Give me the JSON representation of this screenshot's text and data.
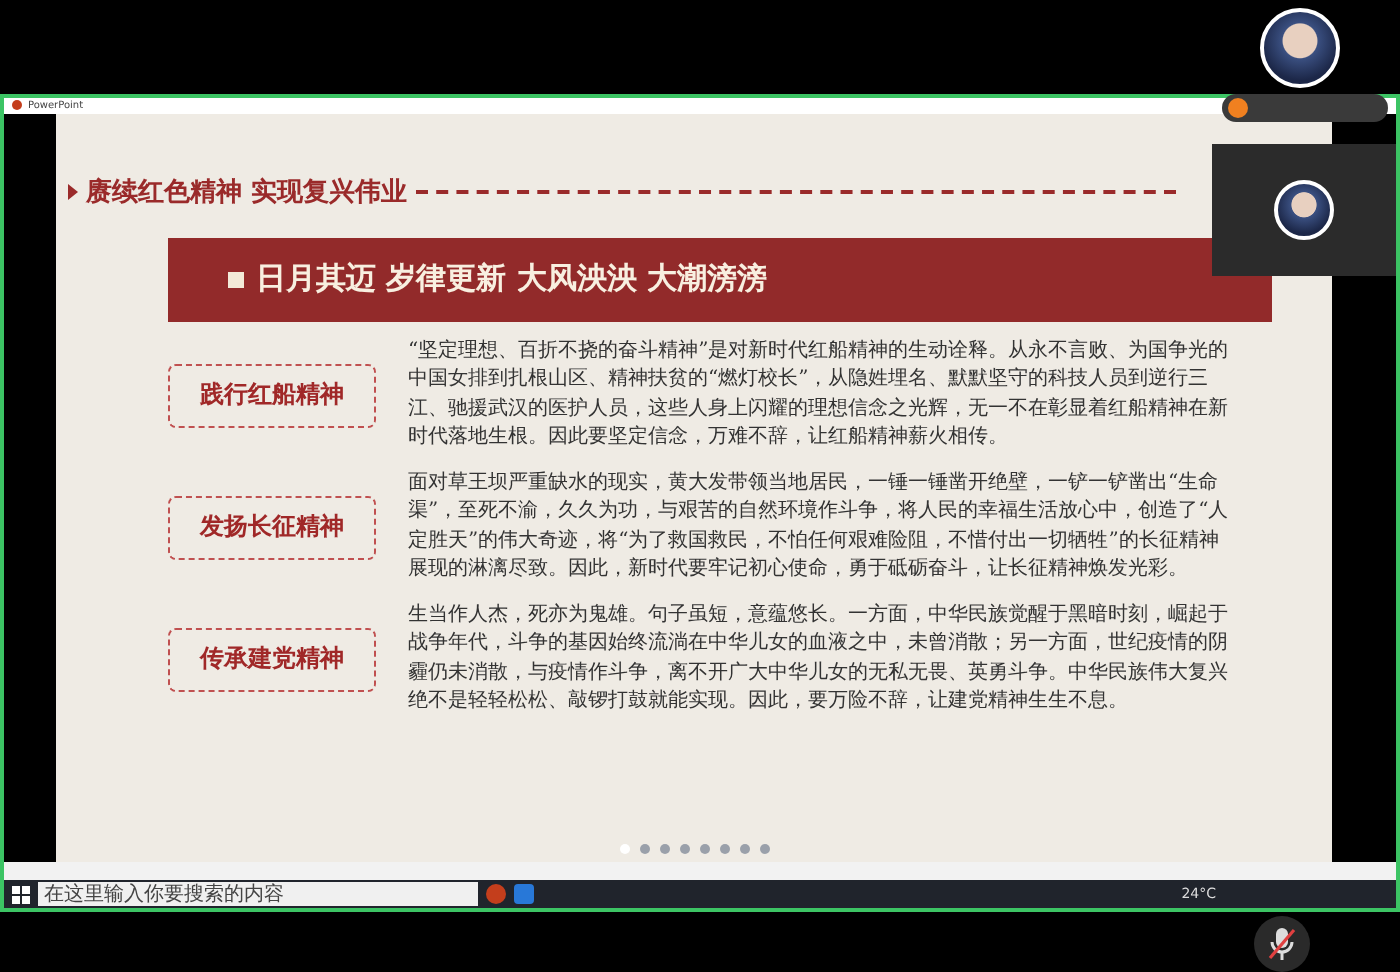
{
  "shared_window": {
    "title": "PowerPoint"
  },
  "slide": {
    "heading": "赓续红色精神 实现复兴伟业",
    "banner": "日月其迈 岁律更新 大风泱泱 大潮滂滂",
    "sections": [
      {
        "label": "践行红船精神",
        "text": "“坚定理想、百折不挠的奋斗精神”是对新时代红船精神的生动诠释。从永不言败、为国争光的中国女排到扎根山区、精神扶贫的“燃灯校长”，从隐姓埋名、默默坚守的科技人员到逆行三江、驰援武汉的医护人员，这些人身上闪耀的理想信念之光辉，无一不在彰显着红船精神在新时代落地生根。因此要坚定信念，万难不辞，让红船精神薪火相传。"
      },
      {
        "label": "发扬长征精神",
        "text": "面对草王坝严重缺水的现实，黄大发带领当地居民，一锤一锤凿开绝壁，一铲一铲凿出“生命渠”，至死不渝，久久为功，与艰苦的自然环境作斗争，将人民的幸福生活放心中，创造了“人定胜天”的伟大奇迹，将“为了救国救民，不怕任何艰难险阻，不惜付出一切牺牲”的长征精神展现的淋漓尽致。因此，新时代要牢记初心使命，勇于砥砺奋斗，让长征精神焕发光彩。"
      },
      {
        "label": "传承建党精神",
        "text": "生当作人杰，死亦为鬼雄。句子虽短，意蕴悠长。一方面，中华民族觉醒于黑暗时刻，崛起于战争年代，斗争的基因始终流淌在中华儿女的血液之中，未曾消散；另一方面，世纪疫情的阴霾仍未消散，与疫情作斗争，离不开广大中华儿女的无私无畏、英勇斗争。中华民族伟大复兴绝不是轻轻松松、敲锣打鼓就能实现。因此，要万险不辞，让建党精神生生不息。"
      }
    ],
    "page_dots": [
      {
        "selected": true
      },
      {
        "selected": false
      },
      {
        "selected": false
      },
      {
        "selected": false
      },
      {
        "selected": false
      },
      {
        "selected": false
      },
      {
        "selected": false
      },
      {
        "selected": false
      }
    ]
  },
  "taskbar": {
    "search_placeholder": "在这里输入你要搜索的内容",
    "weather": "24°C"
  },
  "microphone": {
    "muted": true
  }
}
